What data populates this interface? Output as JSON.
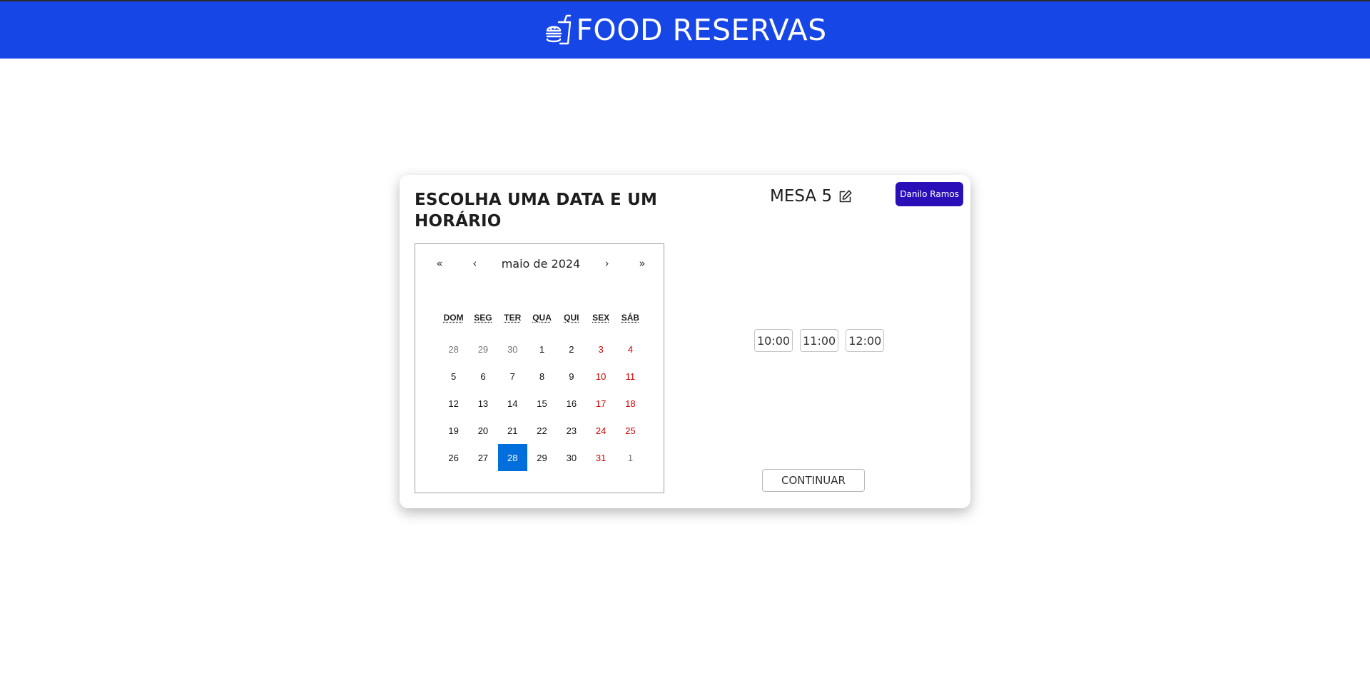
{
  "header": {
    "title": "FOOD RESERVAS",
    "logo_icon": "burger-drink-icon",
    "bg_color": "#1746e6"
  },
  "card": {
    "title": "ESCOLHA UMA DATA E UM HORÁRIO",
    "table_label": "MESA 5",
    "edit_icon": "edit-icon",
    "user_name": "Danilo Ramos",
    "user_badge_color": "#2a0fb8"
  },
  "calendar": {
    "nav": {
      "prev_year": "«",
      "prev_month": "‹",
      "month_label": "maio de 2024",
      "next_month": "›",
      "next_year": "»"
    },
    "weekdays": [
      "DOM",
      "SEG",
      "TER",
      "QUA",
      "QUI",
      "SEX",
      "SÁB"
    ],
    "days": [
      {
        "label": "28",
        "muted": true,
        "weekend": false
      },
      {
        "label": "29",
        "muted": true,
        "weekend": false
      },
      {
        "label": "30",
        "muted": true,
        "weekend": false
      },
      {
        "label": "1",
        "muted": false,
        "weekend": false
      },
      {
        "label": "2",
        "muted": false,
        "weekend": false
      },
      {
        "label": "3",
        "muted": false,
        "weekend": true
      },
      {
        "label": "4",
        "muted": false,
        "weekend": true
      },
      {
        "label": "5",
        "muted": false,
        "weekend": false
      },
      {
        "label": "6",
        "muted": false,
        "weekend": false
      },
      {
        "label": "7",
        "muted": false,
        "weekend": false
      },
      {
        "label": "8",
        "muted": false,
        "weekend": false
      },
      {
        "label": "9",
        "muted": false,
        "weekend": false
      },
      {
        "label": "10",
        "muted": false,
        "weekend": true
      },
      {
        "label": "11",
        "muted": false,
        "weekend": true
      },
      {
        "label": "12",
        "muted": false,
        "weekend": false
      },
      {
        "label": "13",
        "muted": false,
        "weekend": false
      },
      {
        "label": "14",
        "muted": false,
        "weekend": false
      },
      {
        "label": "15",
        "muted": false,
        "weekend": false
      },
      {
        "label": "16",
        "muted": false,
        "weekend": false
      },
      {
        "label": "17",
        "muted": false,
        "weekend": true
      },
      {
        "label": "18",
        "muted": false,
        "weekend": true
      },
      {
        "label": "19",
        "muted": false,
        "weekend": false
      },
      {
        "label": "20",
        "muted": false,
        "weekend": false
      },
      {
        "label": "21",
        "muted": false,
        "weekend": false
      },
      {
        "label": "22",
        "muted": false,
        "weekend": false
      },
      {
        "label": "23",
        "muted": false,
        "weekend": false
      },
      {
        "label": "24",
        "muted": false,
        "weekend": true
      },
      {
        "label": "25",
        "muted": false,
        "weekend": true
      },
      {
        "label": "26",
        "muted": false,
        "weekend": false
      },
      {
        "label": "27",
        "muted": false,
        "weekend": false
      },
      {
        "label": "28",
        "muted": false,
        "weekend": false,
        "selected": true
      },
      {
        "label": "29",
        "muted": false,
        "weekend": false
      },
      {
        "label": "30",
        "muted": false,
        "weekend": false
      },
      {
        "label": "31",
        "muted": false,
        "weekend": true
      },
      {
        "label": "1",
        "muted": true,
        "weekend": true
      }
    ],
    "selected_color": "#006edc",
    "weekend_color": "#d10000"
  },
  "times": [
    "10:00",
    "11:00",
    "12:00"
  ],
  "actions": {
    "continue_label": "CONTINUAR"
  }
}
